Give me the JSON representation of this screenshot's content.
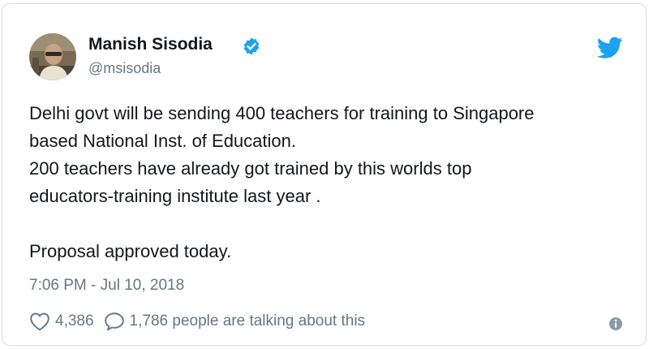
{
  "author": {
    "name": "Manish Sisodia",
    "handle": "@msisodia",
    "verified": true,
    "avatar_icon": "avatar-photo"
  },
  "tweet": {
    "lines": [
      "Delhi govt will be sending 400 teachers for training to Singapore",
      "based National Inst. of Education.",
      "200 teachers have already got trained by this worlds top",
      "educators-training institute last year .",
      "",
      "Proposal approved today."
    ]
  },
  "meta": {
    "timestamp": "7:06 PM - Jul 10, 2018"
  },
  "actions": {
    "like_count": "4,386",
    "reply_text": "1,786 people are talking about this"
  },
  "icons": {
    "brand": "twitter-bird-icon",
    "verified": "verified-badge-icon",
    "like": "heart-icon",
    "reply": "speech-bubble-icon",
    "info": "info-icon"
  },
  "colors": {
    "brand": "#1da1f2",
    "text": "#14171a",
    "muted": "#657786",
    "border": "#d8dde2"
  }
}
